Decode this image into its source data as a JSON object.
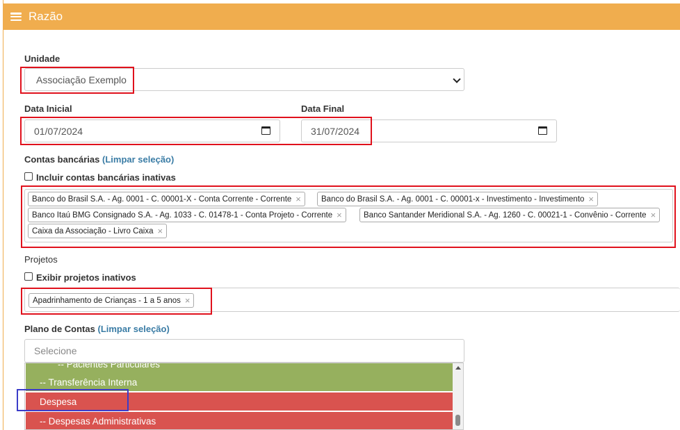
{
  "header": {
    "title": "Razão"
  },
  "unidade": {
    "label": "Unidade",
    "value": "Associação Exemplo"
  },
  "data_inicial": {
    "label": "Data Inicial",
    "value": "01/07/2024"
  },
  "data_final": {
    "label": "Data Final",
    "value": "31/07/2024"
  },
  "contas": {
    "label": "Contas bancárias",
    "clear_link": "(Limpar seleção)",
    "inactive_checkbox": "Incluir contas bancárias inativas",
    "tags": [
      "Banco do Brasil S.A. - Ag. 0001 - C. 00001-X - Conta Corrente - Corrente",
      "Banco do Brasil S.A. - Ag. 0001 - C. 00001-x - Investimento - Investimento",
      "Banco Itaú BMG Consignado S.A. - Ag. 1033 - C. 01478-1 - Conta Projeto - Corrente",
      "Banco Santander Meridional S.A. - Ag. 1260 - C. 00021-1 - Convênio - Corrente",
      "Caixa da Associação - Livro Caixa"
    ]
  },
  "projetos": {
    "label": "Projetos",
    "inactive_checkbox": "Exibir projetos inativos",
    "tags": [
      "Apadrinhamento de Crianças - 1 a 5 anos"
    ]
  },
  "plano": {
    "label": "Plano de Contas",
    "clear_link": "(Limpar seleção)",
    "placeholder": "Selecione",
    "options": [
      {
        "label": "-- Pacientes Particulares",
        "color": "#96b05e"
      },
      {
        "label": "-- Transferência Interna",
        "color": "#96b05e"
      },
      {
        "label": "Despesa",
        "color": "#d9534f"
      },
      {
        "label": "-- Despesas Administrativas",
        "color": "#d9534f"
      }
    ]
  },
  "colors": {
    "header": "#f0ad4e",
    "highlight_red": "#e0111c",
    "highlight_blue": "#3b3cc8"
  }
}
